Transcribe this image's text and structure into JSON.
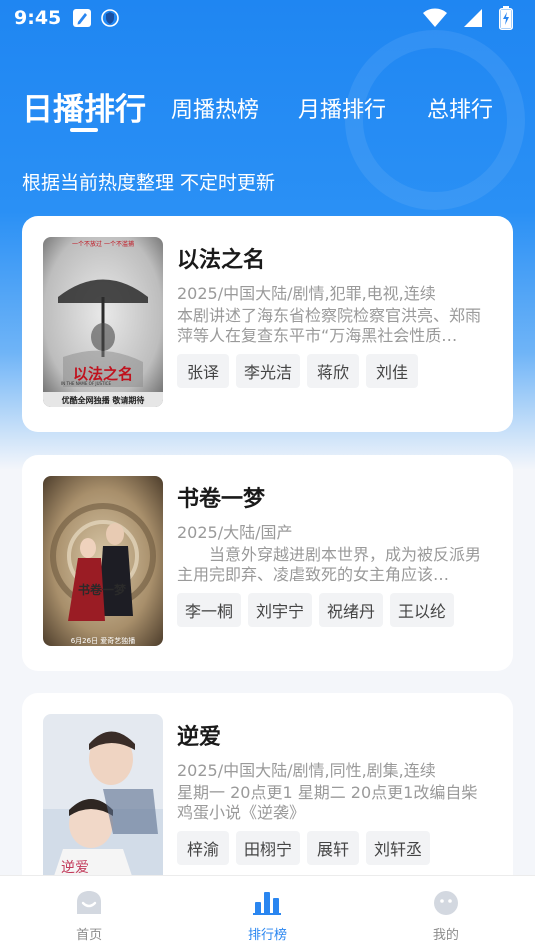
{
  "status_bar": {
    "time": "9:45",
    "icons": [
      "edit-note-icon",
      "shield-icon",
      "wifi-icon",
      "signal-icon",
      "battery-charging-icon"
    ]
  },
  "tabs": [
    {
      "label": "日播排行",
      "active": true
    },
    {
      "label": "周播热榜",
      "active": false
    },
    {
      "label": "月播排行",
      "active": false
    },
    {
      "label": "总排行",
      "active": false
    }
  ],
  "subtitle": "根据当前热度整理 不定时更新",
  "colors": {
    "primary": "#2a86f0",
    "hero_top": "#1f86f2",
    "background": "#f4f6fa",
    "tag_bg": "#f2f3f5",
    "meta_text": "#9a9a9a"
  },
  "shows": [
    {
      "title": "以法之名",
      "meta": "2025/中国大陆/剧情,犯罪,电视,连续",
      "description": "本剧讲述了海东省检察院检察官洪亮、郑雨萍等人在复查东平市“万海黑社会性质…",
      "tags": [
        "张译",
        "李光洁",
        "蒋欣",
        "刘佳"
      ],
      "poster": {
        "top_text": "一个不放过    一个不滥捕",
        "title_text": "以法之名",
        "en_text": "IN THE NAME OF JUSTICE",
        "bottom_text": "优酷全网独播 敬请期待"
      }
    },
    {
      "title": "书卷一梦",
      "meta": "2025/大陆/国产",
      "description": "　　当意外穿越进剧本世界，成为被反派男主用完即弃、凌虐致死的女主角应该…",
      "tags": [
        "李一桐",
        "刘宇宁",
        "祝绪丹",
        "王以纶"
      ],
      "poster": {
        "title_text": "书卷一梦",
        "bottom_text": "6月26日 爱奇艺独播"
      }
    },
    {
      "title": "逆爱",
      "meta": "2025/中国大陆/剧情,同性,剧集,连续",
      "description": "星期一 20点更1 星期二 20点更1改编自柴鸡蛋小说《逆袭》",
      "tags": [
        "梓渝",
        "田栩宁",
        "展轩",
        "刘轩丞"
      ],
      "poster": {
        "title_text": "逆爱"
      }
    }
  ],
  "bottom_nav": [
    {
      "label": "首页",
      "icon": "home-face-icon",
      "active": false
    },
    {
      "label": "排行榜",
      "icon": "bar-chart-icon",
      "active": true
    },
    {
      "label": "我的",
      "icon": "profile-face-icon",
      "active": false
    }
  ]
}
